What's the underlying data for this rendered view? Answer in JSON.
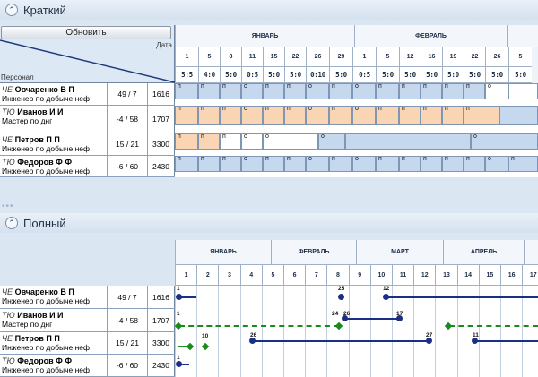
{
  "short_section": {
    "title": "Краткий"
  },
  "full_section": {
    "title": "Полный"
  },
  "corner": {
    "refresh_label": "Обновить",
    "date_label": "Дата",
    "personnel_label": "Персонал"
  },
  "short_timeline": {
    "months": [
      "ЯНВАРЬ",
      "ФЕВРАЛЬ"
    ],
    "days": [
      "1",
      "5",
      "8",
      "11",
      "15",
      "22",
      "26",
      "29",
      "1",
      "5",
      "12",
      "16",
      "19",
      "22",
      "26",
      "5"
    ],
    "durations": [
      "5:5",
      "4:0",
      "5:0",
      "0:5",
      "5:0",
      "5:0",
      "0:10",
      "5:0",
      "0:5",
      "5:0",
      "5:0",
      "5:0",
      "5:0",
      "5:0",
      "5:0",
      "5:0"
    ]
  },
  "full_timeline": {
    "months": [
      "ЯНВАРЬ",
      "ФЕВРАЛЬ",
      "МАРТ",
      "АПРЕЛЬ"
    ],
    "weeks": [
      "1",
      "2",
      "3",
      "4",
      "5",
      "6",
      "7",
      "8",
      "9",
      "10",
      "11",
      "12",
      "13",
      "14",
      "15",
      "16",
      "17"
    ]
  },
  "personnel": [
    {
      "code": "ЧЕ",
      "name": "Овчаренко В П",
      "role": "Инженер по добыче неф",
      "ratio": "49 / 7",
      "number": "1616"
    },
    {
      "code": "ТЮ",
      "name": "Иванов И И",
      "role": "Мастер по днг",
      "ratio": "-4 / 58",
      "number": "1707"
    },
    {
      "code": "ЧЕ",
      "name": "Петров П П",
      "role": "Инженер по добыче неф",
      "ratio": "15 / 21",
      "number": "3300"
    },
    {
      "code": "ТЮ",
      "name": "Федоров Ф Ф",
      "role": "Инженер по добыче неф",
      "ratio": "-6 / 60",
      "number": "2430"
    }
  ],
  "short_marks": {
    "p": "п",
    "o": "о"
  },
  "full_labels": {
    "row0": [
      "1",
      "25",
      "12"
    ],
    "row1": [
      "1",
      "24",
      "26",
      "17"
    ],
    "row2": [
      "10",
      "26",
      "27",
      "11"
    ],
    "row3": [
      "1"
    ]
  },
  "colors": {
    "work": "#c5d8ee",
    "rest": "#f9d5b3",
    "free": "#ffffff",
    "line": "#1c2f86",
    "dashed": "#1b8a1b"
  }
}
